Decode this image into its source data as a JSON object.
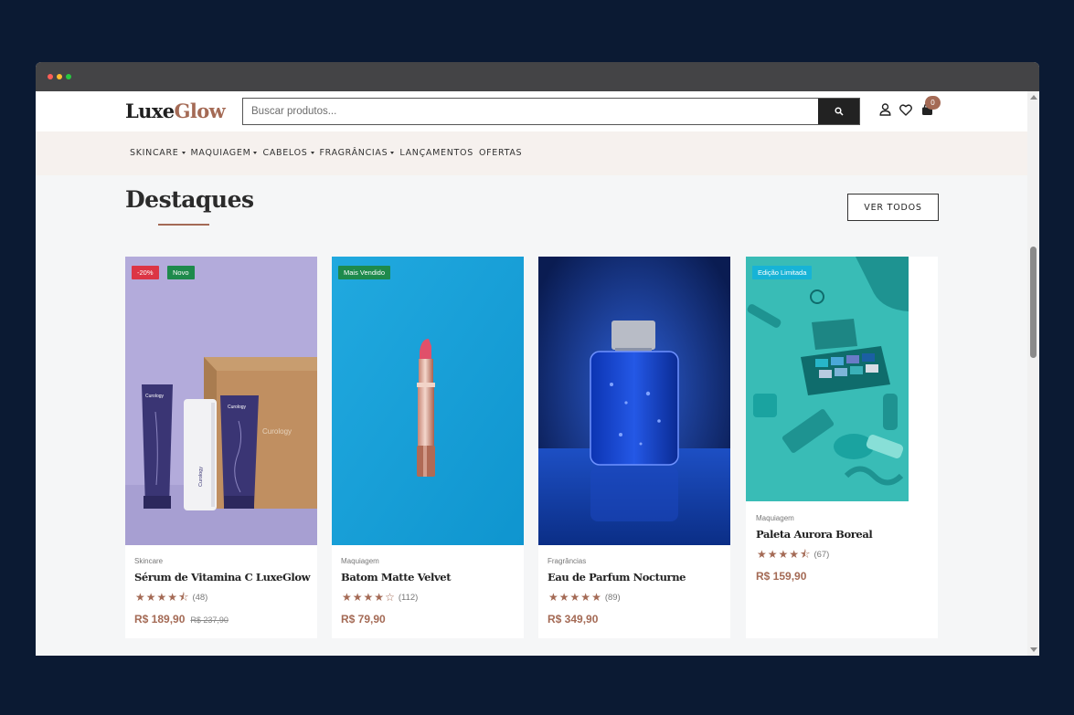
{
  "brand": {
    "part1": "Luxe",
    "part2": "Glow"
  },
  "search": {
    "placeholder": "Buscar produtos..."
  },
  "cart": {
    "count": "0"
  },
  "nav": [
    {
      "label": "SKINCARE",
      "dropdown": true
    },
    {
      "label": "MAQUIAGEM",
      "dropdown": true
    },
    {
      "label": "CABELOS",
      "dropdown": true
    },
    {
      "label": "FRAGRÂNCIAS",
      "dropdown": true
    },
    {
      "label": "LANÇAMENTOS",
      "dropdown": false
    },
    {
      "label": "OFERTAS",
      "dropdown": false
    }
  ],
  "section": {
    "title": "Destaques",
    "view_all": "VER TODOS"
  },
  "products": [
    {
      "category": "Skincare",
      "name": "Sérum de Vitamina C LuxeGlow",
      "rating": 4.5,
      "reviews": "(48)",
      "price": "R$ 189,90",
      "old_price": "R$ 237,90",
      "badges": [
        {
          "label": "-20%",
          "color": "#dc3545"
        },
        {
          "label": "Novo",
          "color": "#1e8a4c"
        }
      ],
      "product_brand": "Curology"
    },
    {
      "category": "Maquiagem",
      "name": "Batom Matte Velvet",
      "rating": 4,
      "reviews": "(112)",
      "price": "R$ 79,90",
      "old_price": "",
      "badges": [
        {
          "label": "Mais Vendido",
          "color": "#1e8a4c"
        }
      ]
    },
    {
      "category": "Fragrâncias",
      "name": "Eau de Parfum Nocturne",
      "rating": 5,
      "reviews": "(89)",
      "price": "R$ 349,90",
      "old_price": "",
      "badges": []
    },
    {
      "category": "Maquiagem",
      "name": "Paleta Aurora Boreal",
      "rating": 4.5,
      "reviews": "(67)",
      "price": "R$ 159,90",
      "old_price": "",
      "badges": [
        {
          "label": "Edição Limitada",
          "color": "#17b3d6"
        }
      ]
    }
  ],
  "colors": {
    "accent": "#a46a55",
    "nav_bg": "#f6f1ee",
    "page_bg": "#0b1a33"
  },
  "icons": [
    "search-icon",
    "user-icon",
    "heart-icon",
    "cart-icon",
    "star-icon"
  ]
}
